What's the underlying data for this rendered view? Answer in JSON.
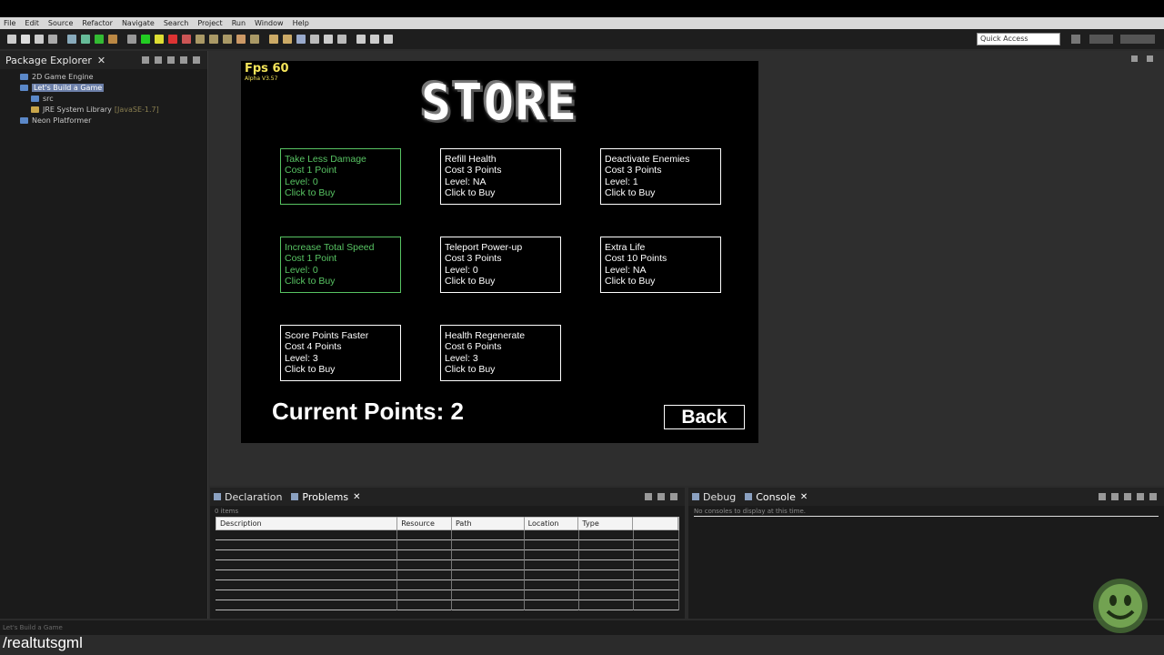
{
  "menu": [
    "File",
    "Edit",
    "Source",
    "Refactor",
    "Navigate",
    "Search",
    "Project",
    "Run",
    "Window",
    "Help"
  ],
  "quick_access": {
    "placeholder": "Quick Access"
  },
  "package_explorer": {
    "title": "Package Explorer",
    "items": [
      {
        "label": "2D Game Engine",
        "indent": 0
      },
      {
        "label": "Let's Build a Game",
        "indent": 0,
        "selected": true
      },
      {
        "label": "src",
        "indent": 1
      },
      {
        "label": "JRE System Library",
        "extra": "[JavaSE-1.7]",
        "indent": 1
      },
      {
        "label": "Neon Platformer",
        "indent": 0
      }
    ]
  },
  "game": {
    "fps": "Fps 60",
    "version": "Alpha V3.57",
    "title": "STORE",
    "items": [
      {
        "name": "Take Less Damage",
        "cost": "Cost 1 Point",
        "level": "Level: 0",
        "action": "Click to Buy",
        "owned": true
      },
      {
        "name": "Refill Health",
        "cost": "Cost 3 Points",
        "level": "Level: NA",
        "action": "Click to Buy",
        "owned": false
      },
      {
        "name": "Deactivate Enemies",
        "cost": "Cost 3 Points",
        "level": "Level: 1",
        "action": "Click to Buy",
        "owned": false
      },
      {
        "name": "Increase Total Speed",
        "cost": "Cost 1 Point",
        "level": "Level: 0",
        "action": "Click to Buy",
        "owned": true
      },
      {
        "name": "Teleport Power-up",
        "cost": "Cost 3 Points",
        "level": "Level: 0",
        "action": "Click to Buy",
        "owned": false
      },
      {
        "name": "Extra Life",
        "cost": "Cost 10 Points",
        "level": "Level: NA",
        "action": "Click to Buy",
        "owned": false
      },
      {
        "name": "Score Points Faster",
        "cost": "Cost 4 Points",
        "level": "Level: 3",
        "action": "Click to Buy",
        "owned": false
      },
      {
        "name": "Health Regenerate",
        "cost": "Cost 6 Points",
        "level": "Level: 3",
        "action": "Click to Buy",
        "owned": false
      }
    ],
    "current_points": "Current Points: 2",
    "back_label": "Back"
  },
  "problems_panel": {
    "tabs": [
      {
        "label": "Declaration"
      },
      {
        "label": "Problems",
        "active": true
      }
    ],
    "count": "0 items",
    "columns": [
      "Description",
      "Resource",
      "Path",
      "Location",
      "Type"
    ]
  },
  "console_panel": {
    "tabs": [
      {
        "label": "Debug"
      },
      {
        "label": "Console",
        "active": true
      }
    ],
    "message": "No consoles to display at this time."
  },
  "status": "Let's Build a Game",
  "watermark": "/realtutsgml",
  "colors": {
    "owned": "#58c463",
    "fps": "#f4e45a",
    "selected": "#6c7fa8"
  }
}
